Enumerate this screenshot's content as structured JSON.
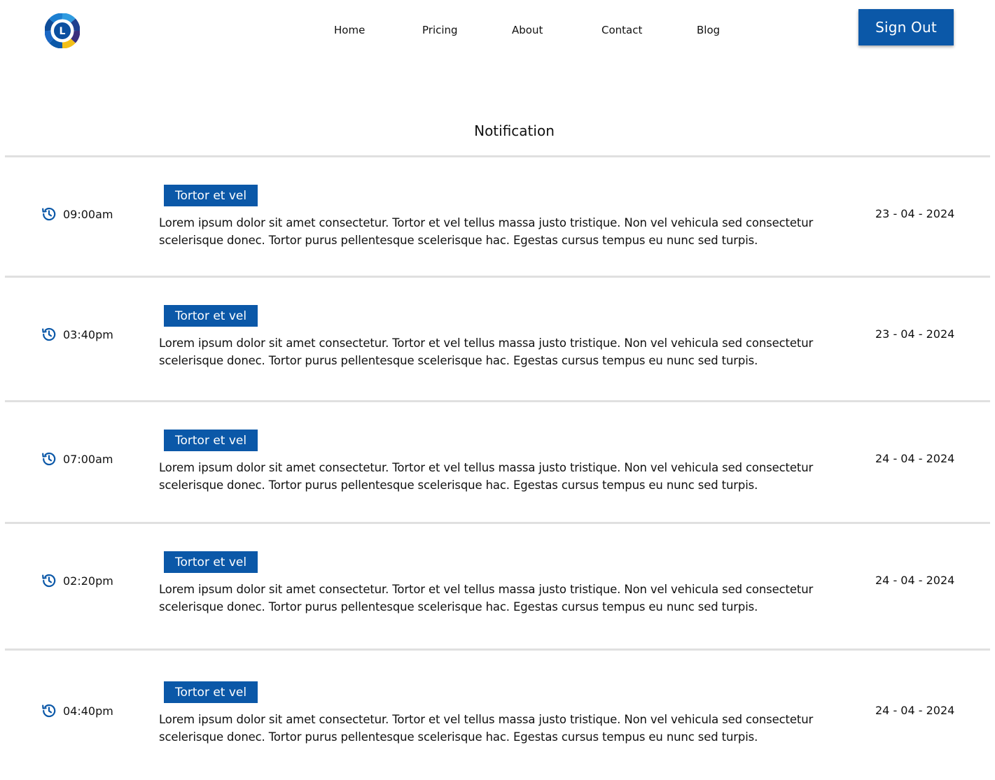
{
  "header": {
    "logo_letter": "L",
    "nav": [
      "Home",
      "Pricing",
      "About",
      "Contact",
      "Blog"
    ],
    "sign_out_label": "Sign Out"
  },
  "page": {
    "title": "Notification"
  },
  "colors": {
    "brand_blue": "#0b58a8",
    "divider": "#e0e0e0"
  },
  "icons": {
    "time": "history-clock-icon"
  },
  "notifications": [
    {
      "time": "09:00am",
      "tag": "Tortor et vel",
      "message": "Lorem ipsum dolor sit amet consectetur. Tortor et vel tellus massa justo tristique. Non vel vehicula sed consectetur scelerisque donec. Tortor purus pellentesque scelerisque hac. Egestas cursus tempus eu nunc sed turpis.",
      "date": "23 - 04 - 2024"
    },
    {
      "time": "03:40pm",
      "tag": "Tortor et vel",
      "message": "Lorem ipsum dolor sit amet consectetur. Tortor et vel tellus massa justo tristique. Non vel vehicula sed consectetur scelerisque donec. Tortor purus pellentesque scelerisque hac. Egestas cursus tempus eu nunc sed turpis.",
      "date": "23 - 04 - 2024"
    },
    {
      "time": "07:00am",
      "tag": "Tortor et vel",
      "message": "Lorem ipsum dolor sit amet consectetur. Tortor et vel tellus massa justo tristique. Non vel vehicula sed consectetur scelerisque donec. Tortor purus pellentesque scelerisque hac. Egestas cursus tempus eu nunc sed turpis.",
      "date": "24 - 04 - 2024"
    },
    {
      "time": "02:20pm",
      "tag": "Tortor et vel",
      "message": "Lorem ipsum dolor sit amet consectetur. Tortor et vel tellus massa justo tristique. Non vel vehicula sed consectetur scelerisque donec. Tortor purus pellentesque scelerisque hac. Egestas cursus tempus eu nunc sed turpis.",
      "date": "24 - 04 - 2024"
    },
    {
      "time": "04:40pm",
      "tag": "Tortor et vel",
      "message": "Lorem ipsum dolor sit amet consectetur. Tortor et vel tellus massa justo tristique. Non vel vehicula sed consectetur scelerisque donec. Tortor purus pellentesque scelerisque hac. Egestas cursus tempus eu nunc sed turpis.",
      "date": "24 - 04 - 2024"
    }
  ]
}
